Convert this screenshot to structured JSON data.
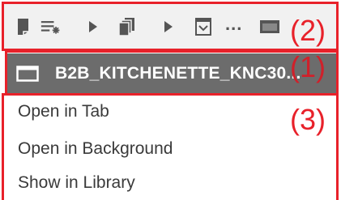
{
  "toolbar": {
    "icons": [
      "bookmark-icon",
      "list-add-icon",
      "play-arrow-icon",
      "copy-pages-icon",
      "play-arrow-icon",
      "archive-box-icon",
      "more-icon",
      "window-icon"
    ],
    "ellipsis": "...",
    "color": "#555555"
  },
  "tab": {
    "title": "B2B_KITCHENETTE_KNC30...",
    "background": "#6c6c6c"
  },
  "context_menu": {
    "items": [
      {
        "label": "Open in Tab"
      },
      {
        "label": "Open in Background"
      },
      {
        "label": "Show in Library"
      }
    ]
  },
  "annotations": {
    "color": "#e8212a",
    "labels": [
      "(1)",
      "(2)",
      "(3)"
    ]
  }
}
